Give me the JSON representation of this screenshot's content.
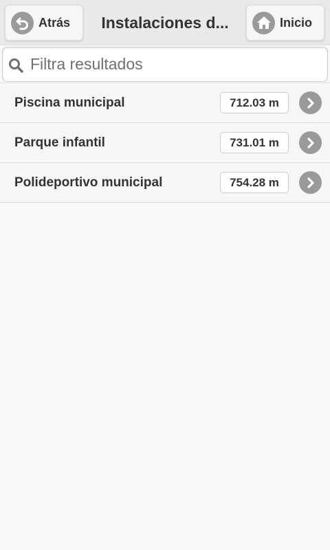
{
  "header": {
    "title": "Instalaciones d...",
    "back_label": "Atrás",
    "home_label": "Inicio"
  },
  "search": {
    "placeholder": "Filtra resultados",
    "value": ""
  },
  "results": [
    {
      "name": "Piscina municipal",
      "distance": "712.03 m"
    },
    {
      "name": "Parque infantil",
      "distance": "731.01 m"
    },
    {
      "name": "Polideportivo municipal",
      "distance": "754.28 m"
    }
  ],
  "icons": {
    "back": "back-arrow-icon",
    "home": "home-icon",
    "search": "search-icon",
    "row_arrow": "chevron-right-icon"
  },
  "colors": {
    "header_bg": "#e9e9e9",
    "icon_bg": "#9a9a9a",
    "row_bg": "#f6f6f6",
    "page_bg": "#f9f9f9",
    "text": "#333333"
  }
}
